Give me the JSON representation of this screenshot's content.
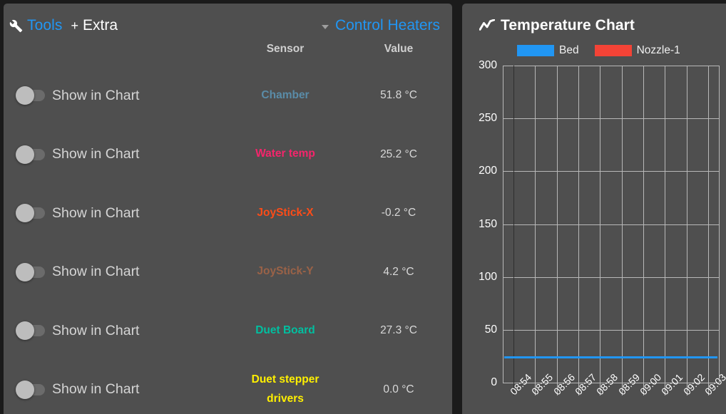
{
  "tools_panel": {
    "header": {
      "wrench_icon": "wrench-icon",
      "tools_label": "Tools",
      "plus_label": "+",
      "extra_label": "Extra",
      "caret_icon": "chevron-down-icon",
      "control_heaters_label": "Control Heaters"
    },
    "columns": {
      "sensor": "Sensor",
      "value": "Value"
    },
    "toggle_label": "Show in Chart",
    "rows": [
      {
        "name": "Chamber",
        "value": "51.8 °C",
        "color": "#5a8ca8",
        "toggle_on": false
      },
      {
        "name": "Water temp",
        "value": "25.2 °C",
        "color": "#f4256b",
        "toggle_on": false
      },
      {
        "name": "JoyStick-X",
        "value": "-0.2 °C",
        "color": "#fc4c18",
        "toggle_on": false
      },
      {
        "name": "JoyStick-Y",
        "value": "4.2 °C",
        "color": "#9a6247",
        "toggle_on": false
      },
      {
        "name": "Duet Board",
        "value": "27.3 °C",
        "color": "#00bfa0",
        "toggle_on": false
      },
      {
        "name": "Duet stepper drivers",
        "value": "0.0 °C",
        "color": "#fff000",
        "toggle_on": false
      }
    ]
  },
  "chart_panel": {
    "icon": "line-chart-icon",
    "title": "Temperature Chart"
  },
  "chart_data": {
    "type": "line",
    "title": "Temperature Chart",
    "xlabel": "",
    "ylabel": "",
    "ylim": [
      0,
      300
    ],
    "yticks": [
      0,
      50,
      100,
      150,
      200,
      250,
      300
    ],
    "x": [
      "08:54",
      "08:55",
      "08:56",
      "08:57",
      "08:58",
      "08:59",
      "09:00",
      "09:01",
      "09:02",
      "09:03"
    ],
    "grid": true,
    "legend_position": "top",
    "series": [
      {
        "name": "Bed",
        "color": "#2196f3",
        "values": [
          24,
          24,
          24,
          24,
          24,
          24,
          24,
          24,
          24,
          24
        ]
      },
      {
        "name": "Nozzle-1",
        "color": "#f44336",
        "values": [
          25,
          25,
          25,
          25,
          25,
          25,
          25,
          25,
          25,
          25
        ]
      }
    ]
  }
}
